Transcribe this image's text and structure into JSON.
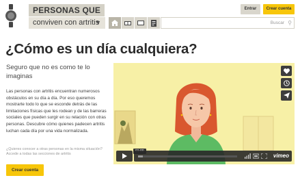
{
  "header": {
    "brand_line1": "PERSONAS QUE",
    "brand_line2": "conviven con artritis",
    "brand_chevron": "chevron-down-icon",
    "nav_icons": [
      "home-icon",
      "book-icon",
      "monitor-icon",
      "document-icon"
    ],
    "search_placeholder": "Buscar",
    "login_label": "Entrar",
    "signup_label": "Crear cuenta"
  },
  "main": {
    "title": "¿Cómo es un día cualquiera?",
    "subtitle": "Seguro que no es como te lo imaginas",
    "body": "Las personas con artritis encuentran numerosos obstáculos en su día a día. Por eso queremos mostrarte todo lo que se esconde detrás de las limitaciones físicas que les rodean y de las barreras sociales que pueden surgir en su relación con otras personas. Descubre cómo quienes padecen artritis luchan cada día por una vida normalizada.",
    "question": "¿Quieres conocer a otras personas en la misma situación? Accede a todas las secciones de artritis",
    "cta_label": "Crear cuenta"
  },
  "video": {
    "time": "01:00",
    "brand": "vimeo",
    "progress": 0.05,
    "side_icons": [
      "heart-icon",
      "clock-icon",
      "send-icon"
    ]
  },
  "colors": {
    "accent": "#f7c60a",
    "video_bg": "#f7f0a6",
    "shirt": "#5dbb63",
    "hair": "#d9572f"
  }
}
